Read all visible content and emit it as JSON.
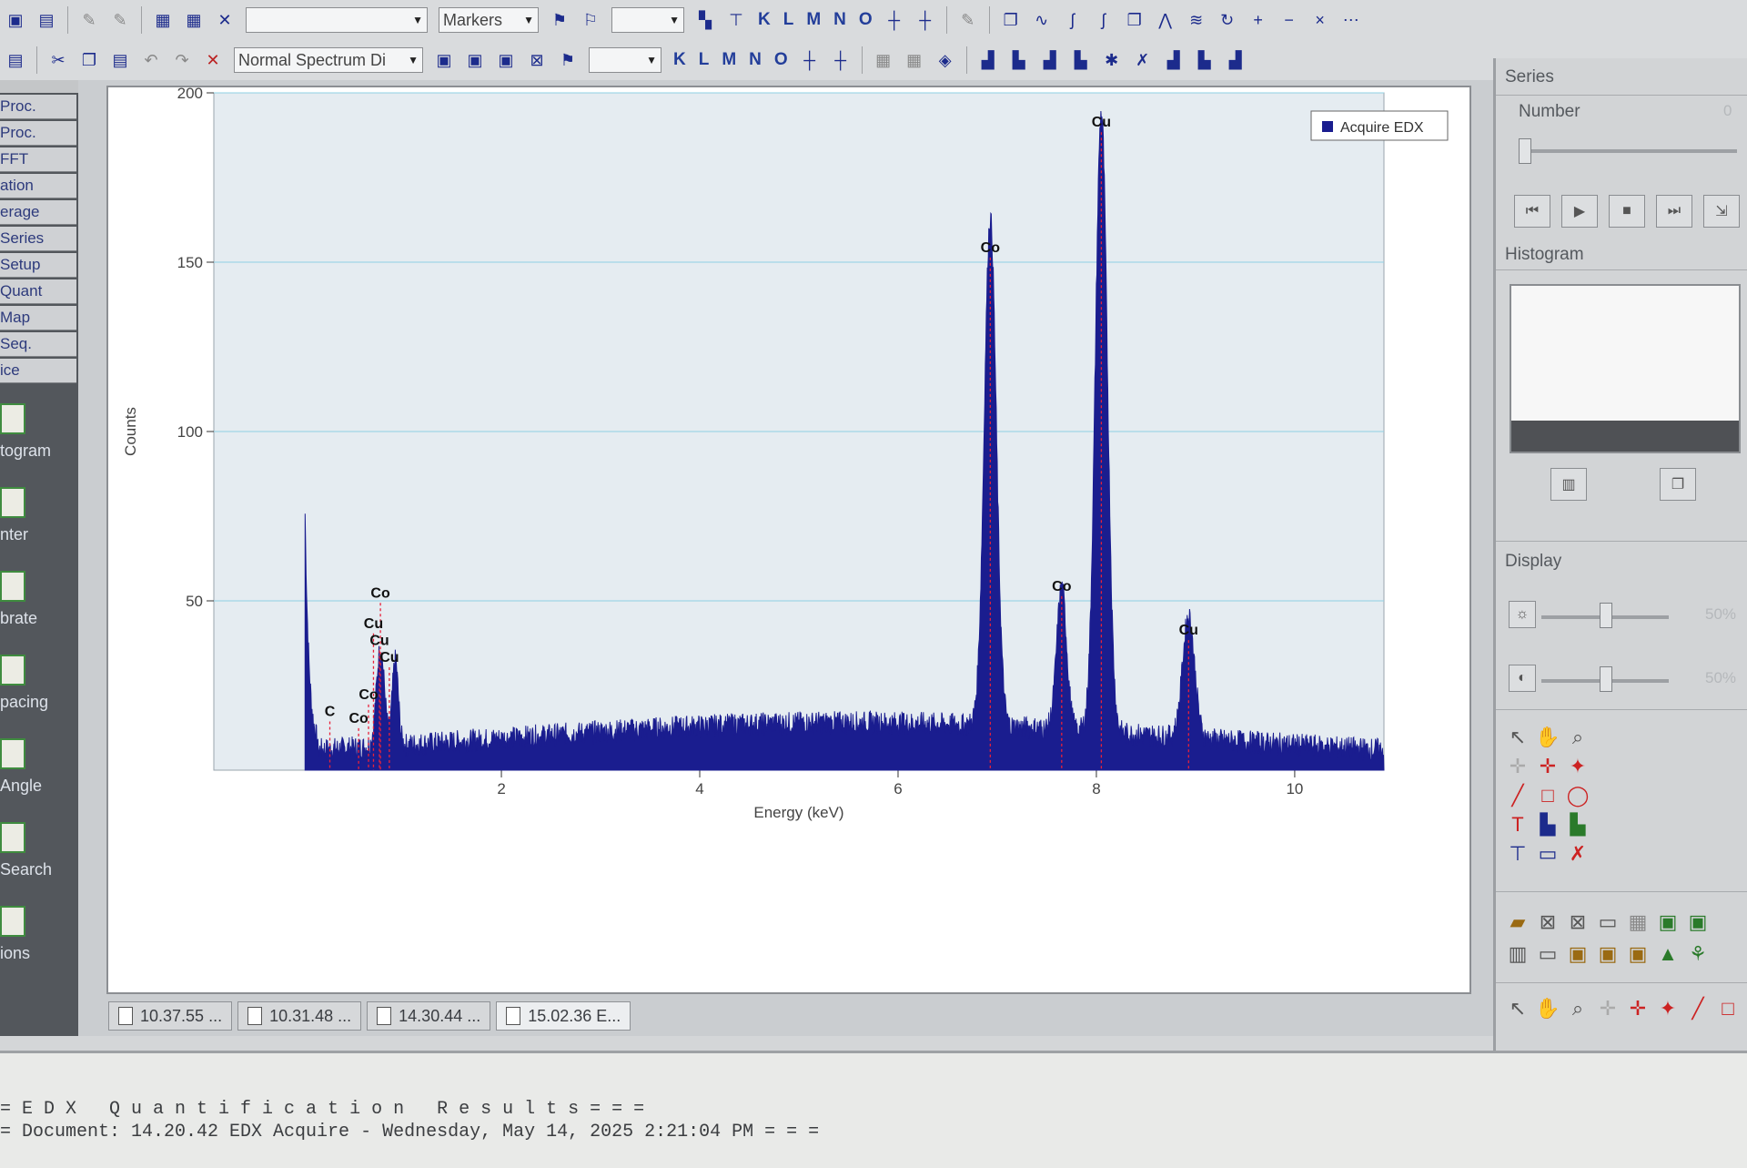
{
  "toolbar1": {
    "combo_empty": "",
    "markers_label": "Markers",
    "letters": [
      "K",
      "L",
      "M",
      "N",
      "O"
    ]
  },
  "toolbar2": {
    "display_mode": "Normal Spectrum Di",
    "letters": [
      "K",
      "L",
      "M",
      "N",
      "O"
    ]
  },
  "sidebar": {
    "items": [
      "Proc.",
      "Proc.",
      "FFT",
      "ation",
      "erage",
      "Series",
      "Setup",
      "Quant",
      "Map",
      "Seq.",
      "ice"
    ],
    "tools": [
      "togram",
      "nter",
      "brate",
      "pacing",
      "Angle",
      "Search",
      "ions"
    ]
  },
  "chart_data": {
    "type": "area",
    "legend": "Acquire EDX",
    "xlabel": "Energy (keV)",
    "ylabel": "Counts",
    "xlim": [
      -0.9,
      10.9
    ],
    "ylim": [
      0,
      200
    ],
    "xticks": [
      2,
      4,
      6,
      8,
      10
    ],
    "yticks": [
      50,
      100,
      150,
      200
    ],
    "grid": true,
    "peaks": [
      {
        "x": 6.93,
        "y": 150,
        "width": 0.06
      },
      {
        "x": 7.65,
        "y": 42,
        "width": 0.05
      },
      {
        "x": 8.05,
        "y": 183,
        "width": 0.06
      },
      {
        "x": 8.93,
        "y": 36,
        "width": 0.06
      },
      {
        "x": 0.78,
        "y": 29,
        "width": 0.04
      },
      {
        "x": 0.93,
        "y": 25,
        "width": 0.03
      }
    ],
    "peak_labels": [
      {
        "text": "Cu",
        "x": 8.05,
        "y": 190
      },
      {
        "text": "Co",
        "x": 6.93,
        "y": 153
      },
      {
        "text": "Co",
        "x": 7.65,
        "y": 53
      },
      {
        "text": "Cu",
        "x": 8.93,
        "y": 40
      },
      {
        "text": "Co",
        "x": 0.78,
        "y": 51
      },
      {
        "text": "Cu",
        "x": 0.71,
        "y": 42
      },
      {
        "text": "Cu",
        "x": 0.77,
        "y": 37
      },
      {
        "text": "Cu",
        "x": 0.87,
        "y": 32
      },
      {
        "text": "Co",
        "x": 0.66,
        "y": 21
      },
      {
        "text": "Co",
        "x": 0.56,
        "y": 14
      },
      {
        "text": "C",
        "x": 0.27,
        "y": 16
      }
    ]
  },
  "tabs": [
    "10.37.55 ...",
    "10.31.48 ...",
    "14.30.44 ...",
    "15.02.36 E..."
  ],
  "right_panel": {
    "series": "Series",
    "number": "Number",
    "number_value": "0",
    "histogram": "Histogram",
    "display": "Display",
    "brightness": "50%",
    "contrast": "50%"
  },
  "results": {
    "line1": "= E D X   Q u a n t i f i c a t i o n   R e s u l t s = = =",
    "line2": "= Document: 14.20.42 EDX Acquire - Wednesday, May 14, 2025 2:21:04 PM = = ="
  },
  "colors": {
    "spectrum": "#1a1d8f",
    "grid": "#8ed0e3",
    "plot_bg": "#e5ecf1",
    "marker": "#e8213a"
  }
}
